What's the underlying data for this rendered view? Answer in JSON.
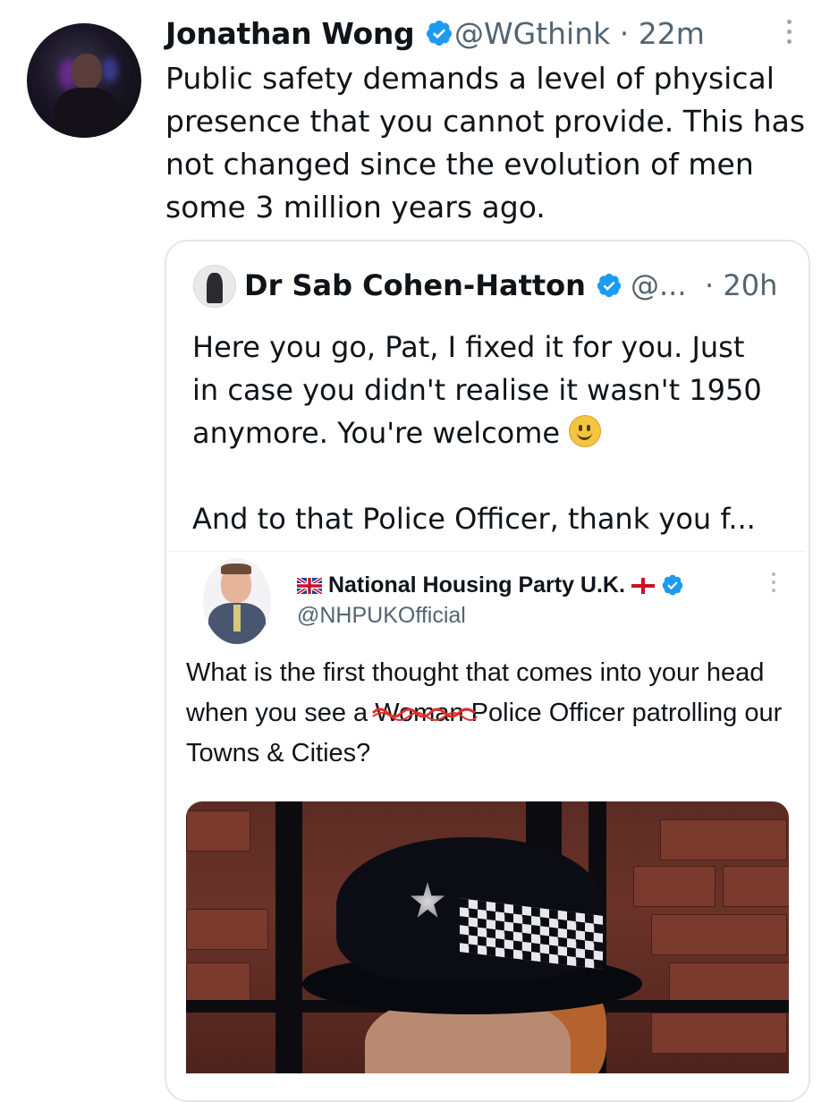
{
  "tweet": {
    "author_name": "Jonathan Wong",
    "handle_time": "@WGthink · 22m",
    "body": "Public safety demands a level of physical\npresence that you cannot provide. This has\nnot changed since the evolution of men\nsome 3 million years ago."
  },
  "quote": {
    "author_name": "Dr Sab Cohen-Hatton",
    "handle": "@...",
    "time": "· 20h",
    "body_1": "Here you go, Pat, I fixed it for you. Just\nin case you didn't realise it wasn't 1950\nanymore. You're welcome ",
    "body_2": "\n\nAnd to that Police Officer, thank you f..."
  },
  "embedded_tweet": {
    "author_name": "National Housing Party U.K.",
    "handle": "@NHPUKOfficial",
    "body_before": "What is the first thought that comes into your head when you see a ",
    "struck_word": "Woman",
    "body_after": " Police Officer patrolling our Towns & Cities?"
  },
  "colors": {
    "verified_blue": "#1d9bf0",
    "text": "#0f1419",
    "secondary": "#536471",
    "border": "#e3e7ea",
    "scribble_red": "#e0302a"
  },
  "icons": [
    "verified-badge-icon",
    "more-options-icon",
    "smiley-emoji-icon",
    "uk-flag-icon",
    "england-flag-icon"
  ]
}
